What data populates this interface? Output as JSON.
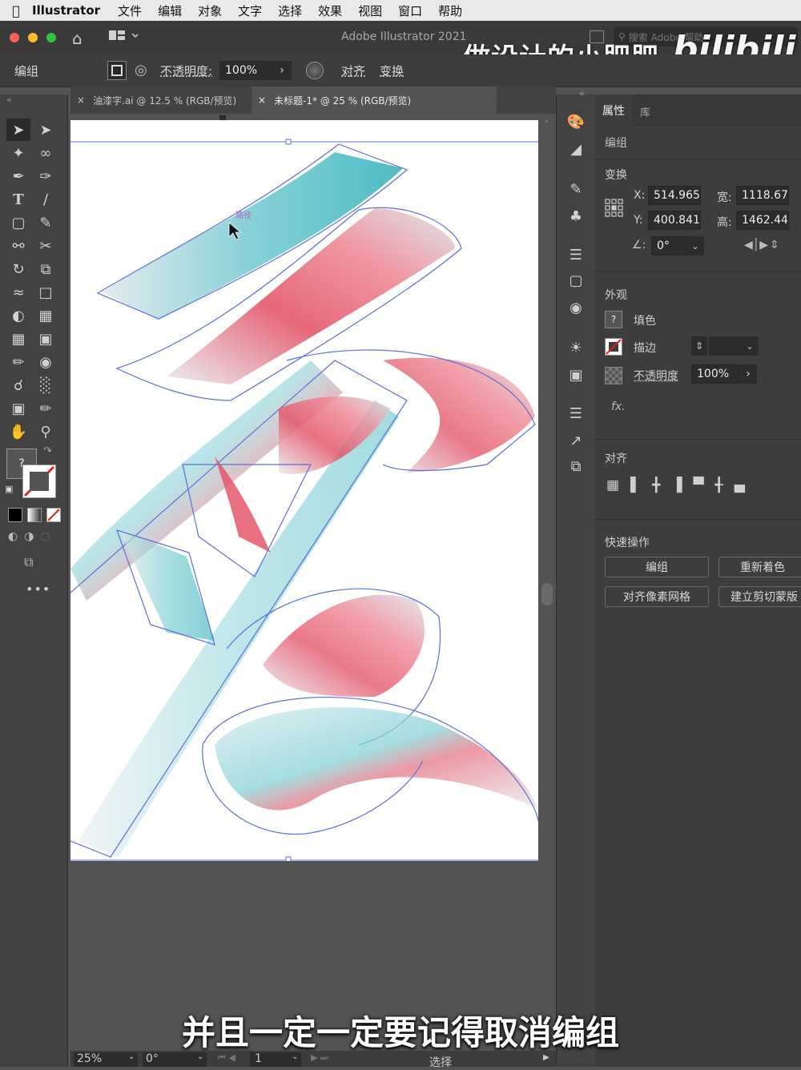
{
  "menubar": {
    "app_name": "Illustrator",
    "items": [
      "文件",
      "编辑",
      "对象",
      "文字",
      "选择",
      "效果",
      "视图",
      "窗口",
      "帮助"
    ]
  },
  "titlebar": {
    "title": "Adobe Illustrator 2021",
    "search_placeholder": "搜索 Adobe 帮助",
    "watermark_text": "做设计的小肥肥",
    "watermark_logo": "bilibili"
  },
  "controlbar": {
    "selection_label": "编组",
    "opacity_label": "不透明度:",
    "opacity_value": "100%",
    "align_label": "对齐",
    "transform_label": "变换"
  },
  "tabs": [
    {
      "label": "油漆字.ai @ 12.5 % (RGB/预览)",
      "active": false
    },
    {
      "label": "未标题-1* @ 25 % (RGB/预览)",
      "active": true
    }
  ],
  "canvas": {
    "cursor_label": "路径"
  },
  "properties": {
    "tabs": [
      "属性",
      "库"
    ],
    "selection": "编组",
    "transform": {
      "title": "变换",
      "x_label": "X:",
      "x_value": "514.965",
      "y_label": "Y:",
      "y_value": "400.841",
      "w_label": "宽:",
      "w_value": "1118.67",
      "h_label": "高:",
      "h_value": "1462.44",
      "angle_value": "0°"
    },
    "appearance": {
      "title": "外观",
      "fill_label": "填色",
      "stroke_label": "描边",
      "opacity_label": "不透明度",
      "opacity_value": "100%",
      "fx_label": "fx."
    },
    "align": {
      "title": "对齐"
    },
    "quick_actions": {
      "title": "快速操作",
      "buttons": [
        "编组",
        "重新着色",
        "对齐像素网格",
        "建立剪切蒙版"
      ]
    }
  },
  "statusbar": {
    "zoom": "25%",
    "rotation": "0°",
    "page": "1",
    "tool_label": "选择"
  },
  "subtitle": "并且一定一定要记得取消编组",
  "colors": {
    "brush_pink": "#e8505e",
    "brush_teal": "#3fb8c0",
    "path_blue": "#5b6fd6"
  }
}
